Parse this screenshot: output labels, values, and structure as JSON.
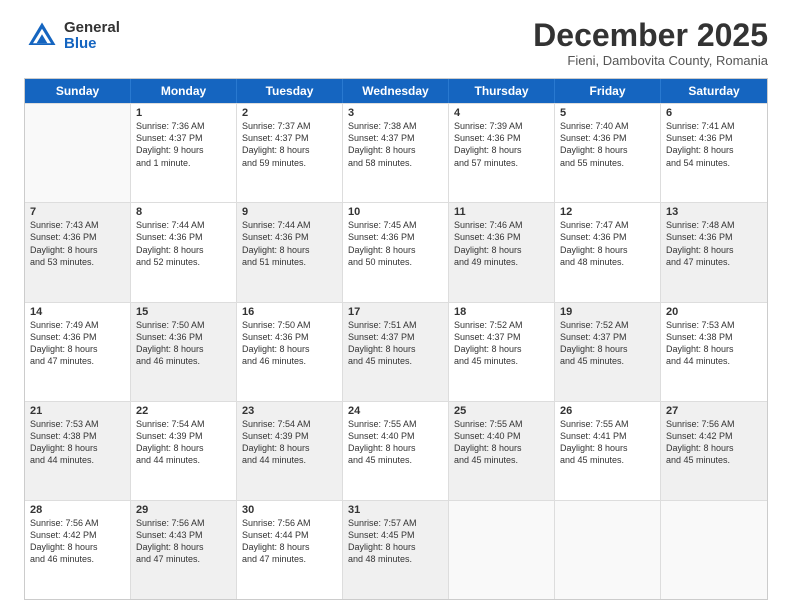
{
  "logo": {
    "general": "General",
    "blue": "Blue"
  },
  "title": "December 2025",
  "subtitle": "Fieni, Dambovita County, Romania",
  "days": [
    "Sunday",
    "Monday",
    "Tuesday",
    "Wednesday",
    "Thursday",
    "Friday",
    "Saturday"
  ],
  "rows": [
    [
      {
        "day": "",
        "lines": [],
        "empty": true
      },
      {
        "day": "1",
        "lines": [
          "Sunrise: 7:36 AM",
          "Sunset: 4:37 PM",
          "Daylight: 9 hours",
          "and 1 minute."
        ]
      },
      {
        "day": "2",
        "lines": [
          "Sunrise: 7:37 AM",
          "Sunset: 4:37 PM",
          "Daylight: 8 hours",
          "and 59 minutes."
        ]
      },
      {
        "day": "3",
        "lines": [
          "Sunrise: 7:38 AM",
          "Sunset: 4:37 PM",
          "Daylight: 8 hours",
          "and 58 minutes."
        ]
      },
      {
        "day": "4",
        "lines": [
          "Sunrise: 7:39 AM",
          "Sunset: 4:36 PM",
          "Daylight: 8 hours",
          "and 57 minutes."
        ]
      },
      {
        "day": "5",
        "lines": [
          "Sunrise: 7:40 AM",
          "Sunset: 4:36 PM",
          "Daylight: 8 hours",
          "and 55 minutes."
        ]
      },
      {
        "day": "6",
        "lines": [
          "Sunrise: 7:41 AM",
          "Sunset: 4:36 PM",
          "Daylight: 8 hours",
          "and 54 minutes."
        ]
      }
    ],
    [
      {
        "day": "7",
        "lines": [
          "Sunrise: 7:43 AM",
          "Sunset: 4:36 PM",
          "Daylight: 8 hours",
          "and 53 minutes."
        ],
        "shaded": true
      },
      {
        "day": "8",
        "lines": [
          "Sunrise: 7:44 AM",
          "Sunset: 4:36 PM",
          "Daylight: 8 hours",
          "and 52 minutes."
        ]
      },
      {
        "day": "9",
        "lines": [
          "Sunrise: 7:44 AM",
          "Sunset: 4:36 PM",
          "Daylight: 8 hours",
          "and 51 minutes."
        ],
        "shaded": true
      },
      {
        "day": "10",
        "lines": [
          "Sunrise: 7:45 AM",
          "Sunset: 4:36 PM",
          "Daylight: 8 hours",
          "and 50 minutes."
        ]
      },
      {
        "day": "11",
        "lines": [
          "Sunrise: 7:46 AM",
          "Sunset: 4:36 PM",
          "Daylight: 8 hours",
          "and 49 minutes."
        ],
        "shaded": true
      },
      {
        "day": "12",
        "lines": [
          "Sunrise: 7:47 AM",
          "Sunset: 4:36 PM",
          "Daylight: 8 hours",
          "and 48 minutes."
        ]
      },
      {
        "day": "13",
        "lines": [
          "Sunrise: 7:48 AM",
          "Sunset: 4:36 PM",
          "Daylight: 8 hours",
          "and 47 minutes."
        ],
        "shaded": true
      }
    ],
    [
      {
        "day": "14",
        "lines": [
          "Sunrise: 7:49 AM",
          "Sunset: 4:36 PM",
          "Daylight: 8 hours",
          "and 47 minutes."
        ]
      },
      {
        "day": "15",
        "lines": [
          "Sunrise: 7:50 AM",
          "Sunset: 4:36 PM",
          "Daylight: 8 hours",
          "and 46 minutes."
        ],
        "shaded": true
      },
      {
        "day": "16",
        "lines": [
          "Sunrise: 7:50 AM",
          "Sunset: 4:36 PM",
          "Daylight: 8 hours",
          "and 46 minutes."
        ]
      },
      {
        "day": "17",
        "lines": [
          "Sunrise: 7:51 AM",
          "Sunset: 4:37 PM",
          "Daylight: 8 hours",
          "and 45 minutes."
        ],
        "shaded": true
      },
      {
        "day": "18",
        "lines": [
          "Sunrise: 7:52 AM",
          "Sunset: 4:37 PM",
          "Daylight: 8 hours",
          "and 45 minutes."
        ]
      },
      {
        "day": "19",
        "lines": [
          "Sunrise: 7:52 AM",
          "Sunset: 4:37 PM",
          "Daylight: 8 hours",
          "and 45 minutes."
        ],
        "shaded": true
      },
      {
        "day": "20",
        "lines": [
          "Sunrise: 7:53 AM",
          "Sunset: 4:38 PM",
          "Daylight: 8 hours",
          "and 44 minutes."
        ]
      }
    ],
    [
      {
        "day": "21",
        "lines": [
          "Sunrise: 7:53 AM",
          "Sunset: 4:38 PM",
          "Daylight: 8 hours",
          "and 44 minutes."
        ],
        "shaded": true
      },
      {
        "day": "22",
        "lines": [
          "Sunrise: 7:54 AM",
          "Sunset: 4:39 PM",
          "Daylight: 8 hours",
          "and 44 minutes."
        ]
      },
      {
        "day": "23",
        "lines": [
          "Sunrise: 7:54 AM",
          "Sunset: 4:39 PM",
          "Daylight: 8 hours",
          "and 44 minutes."
        ],
        "shaded": true
      },
      {
        "day": "24",
        "lines": [
          "Sunrise: 7:55 AM",
          "Sunset: 4:40 PM",
          "Daylight: 8 hours",
          "and 45 minutes."
        ]
      },
      {
        "day": "25",
        "lines": [
          "Sunrise: 7:55 AM",
          "Sunset: 4:40 PM",
          "Daylight: 8 hours",
          "and 45 minutes."
        ],
        "shaded": true
      },
      {
        "day": "26",
        "lines": [
          "Sunrise: 7:55 AM",
          "Sunset: 4:41 PM",
          "Daylight: 8 hours",
          "and 45 minutes."
        ]
      },
      {
        "day": "27",
        "lines": [
          "Sunrise: 7:56 AM",
          "Sunset: 4:42 PM",
          "Daylight: 8 hours",
          "and 45 minutes."
        ],
        "shaded": true
      }
    ],
    [
      {
        "day": "28",
        "lines": [
          "Sunrise: 7:56 AM",
          "Sunset: 4:42 PM",
          "Daylight: 8 hours",
          "and 46 minutes."
        ]
      },
      {
        "day": "29",
        "lines": [
          "Sunrise: 7:56 AM",
          "Sunset: 4:43 PM",
          "Daylight: 8 hours",
          "and 47 minutes."
        ],
        "shaded": true
      },
      {
        "day": "30",
        "lines": [
          "Sunrise: 7:56 AM",
          "Sunset: 4:44 PM",
          "Daylight: 8 hours",
          "and 47 minutes."
        ]
      },
      {
        "day": "31",
        "lines": [
          "Sunrise: 7:57 AM",
          "Sunset: 4:45 PM",
          "Daylight: 8 hours",
          "and 48 minutes."
        ],
        "shaded": true
      },
      {
        "day": "",
        "lines": [],
        "empty": true
      },
      {
        "day": "",
        "lines": [],
        "empty": true
      },
      {
        "day": "",
        "lines": [],
        "empty": true
      }
    ]
  ]
}
